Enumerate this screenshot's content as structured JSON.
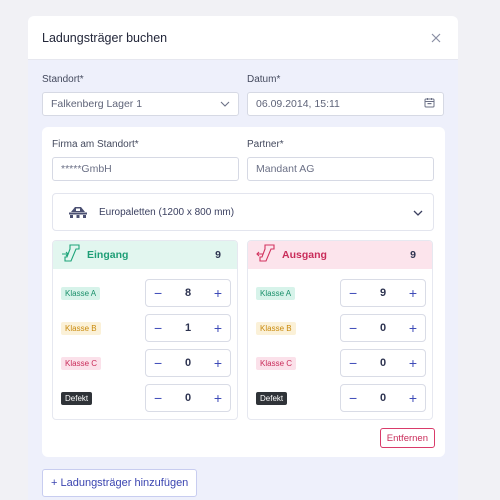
{
  "dialog": {
    "title": "Ladungsträger buchen"
  },
  "standort": {
    "label": "Standort*",
    "value": "Falkenberg Lager 1"
  },
  "datum": {
    "label": "Datum*",
    "value": "06.09.2014, 15:11"
  },
  "firma": {
    "label": "Firma am Standort*",
    "value": "*****GmbH"
  },
  "partner": {
    "label": "Partner*",
    "value": "Mandant AG"
  },
  "pallet": {
    "label": "Europaletten (1200 x 800 mm)"
  },
  "eingang": {
    "title": "Eingang",
    "total": "9",
    "color": "#1ea47a",
    "rows": [
      {
        "badge": "Klasse A",
        "value": "8"
      },
      {
        "badge": "Klasse B",
        "value": "1"
      },
      {
        "badge": "Klasse C",
        "value": "0"
      },
      {
        "badge": "Defekt",
        "value": "0"
      }
    ]
  },
  "ausgang": {
    "title": "Ausgang",
    "total": "9",
    "color": "#d2335f",
    "rows": [
      {
        "badge": "Klasse A",
        "value": "9"
      },
      {
        "badge": "Klasse B",
        "value": "0"
      },
      {
        "badge": "Klasse C",
        "value": "0"
      },
      {
        "badge": "Defekt",
        "value": "0"
      }
    ]
  },
  "actions": {
    "remove_label": "Entfernen",
    "add_label": "+ Ladungsträger hinzufügen"
  },
  "colors": {
    "accent": "#3e4bb8",
    "danger": "#d2335f",
    "success": "#1ea47a"
  }
}
